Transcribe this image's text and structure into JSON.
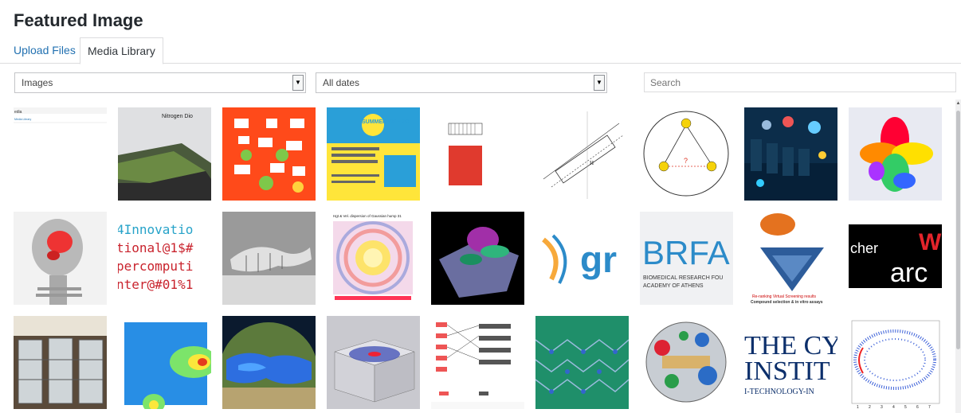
{
  "modal": {
    "title": "Featured Image"
  },
  "tabs": [
    {
      "label": "Upload Files",
      "active": false
    },
    {
      "label": "Media Library",
      "active": true
    }
  ],
  "filters": {
    "type_selected": "Images",
    "date_selected": "All dates",
    "search_placeholder": "Search"
  },
  "thumbnails": {
    "row1": [
      {
        "name": "media-library-screenshot",
        "caption": "edia"
      },
      {
        "name": "nitrogen-dioxide-map",
        "caption": "Nitrogen Dio"
      },
      {
        "name": "fractal-red"
      },
      {
        "name": "summer-of-hpc-poster",
        "caption": "SUMMER OF HPC"
      },
      {
        "name": "red-chart-drawing"
      },
      {
        "name": "geometry-diagram",
        "caption": "H"
      },
      {
        "name": "triangle-diagram",
        "caption": "?"
      },
      {
        "name": "datacenter-render"
      },
      {
        "name": "rainbow-3d-shape"
      }
    ],
    "row2": [
      {
        "name": "skull-xray"
      },
      {
        "name": "innovation-text",
        "lines": [
          "4Innovatio",
          "tional@1$#",
          "percomputi",
          "nter@#01%1"
        ]
      },
      {
        "name": "fish-skeleton"
      },
      {
        "name": "dispersion-plot",
        "caption": "Hgt & Vel. dispersion of Gaussian hump 31"
      },
      {
        "name": "molecule-3d"
      },
      {
        "name": "gr-logo",
        "caption": "gr"
      },
      {
        "name": "brfa-logo",
        "caption": "BRFA",
        "lines": [
          "BIOMEDICAL RESEARCH FOU",
          "ACADEMY OF ATHENS"
        ]
      },
      {
        "name": "virtual-screening-funnel",
        "lines": [
          "Re-ranking Virtual Screening results",
          "Compound selection & in vitro assays"
        ]
      },
      {
        "name": "cher-ar-logo",
        "lines": [
          "cher",
          "W",
          "arc"
        ]
      }
    ],
    "row3": [
      {
        "name": "hardware-cluster"
      },
      {
        "name": "heatmap-simulation"
      },
      {
        "name": "mediterranean-map"
      },
      {
        "name": "wave-cube"
      },
      {
        "name": "network-diagram"
      },
      {
        "name": "green-network"
      },
      {
        "name": "sphere-particles"
      },
      {
        "name": "cyprus-institute-logo",
        "lines": [
          "THE CY",
          "INSTIT",
          "I-TECHNOLOGY-IN"
        ]
      },
      {
        "name": "scatter-ellipse",
        "ticks": [
          "1",
          "2",
          "3",
          "4",
          "5",
          "6",
          "7"
        ]
      }
    ]
  },
  "colors": {
    "accent": "#2271b1",
    "text": "#23282d",
    "border": "#dcdcde"
  }
}
